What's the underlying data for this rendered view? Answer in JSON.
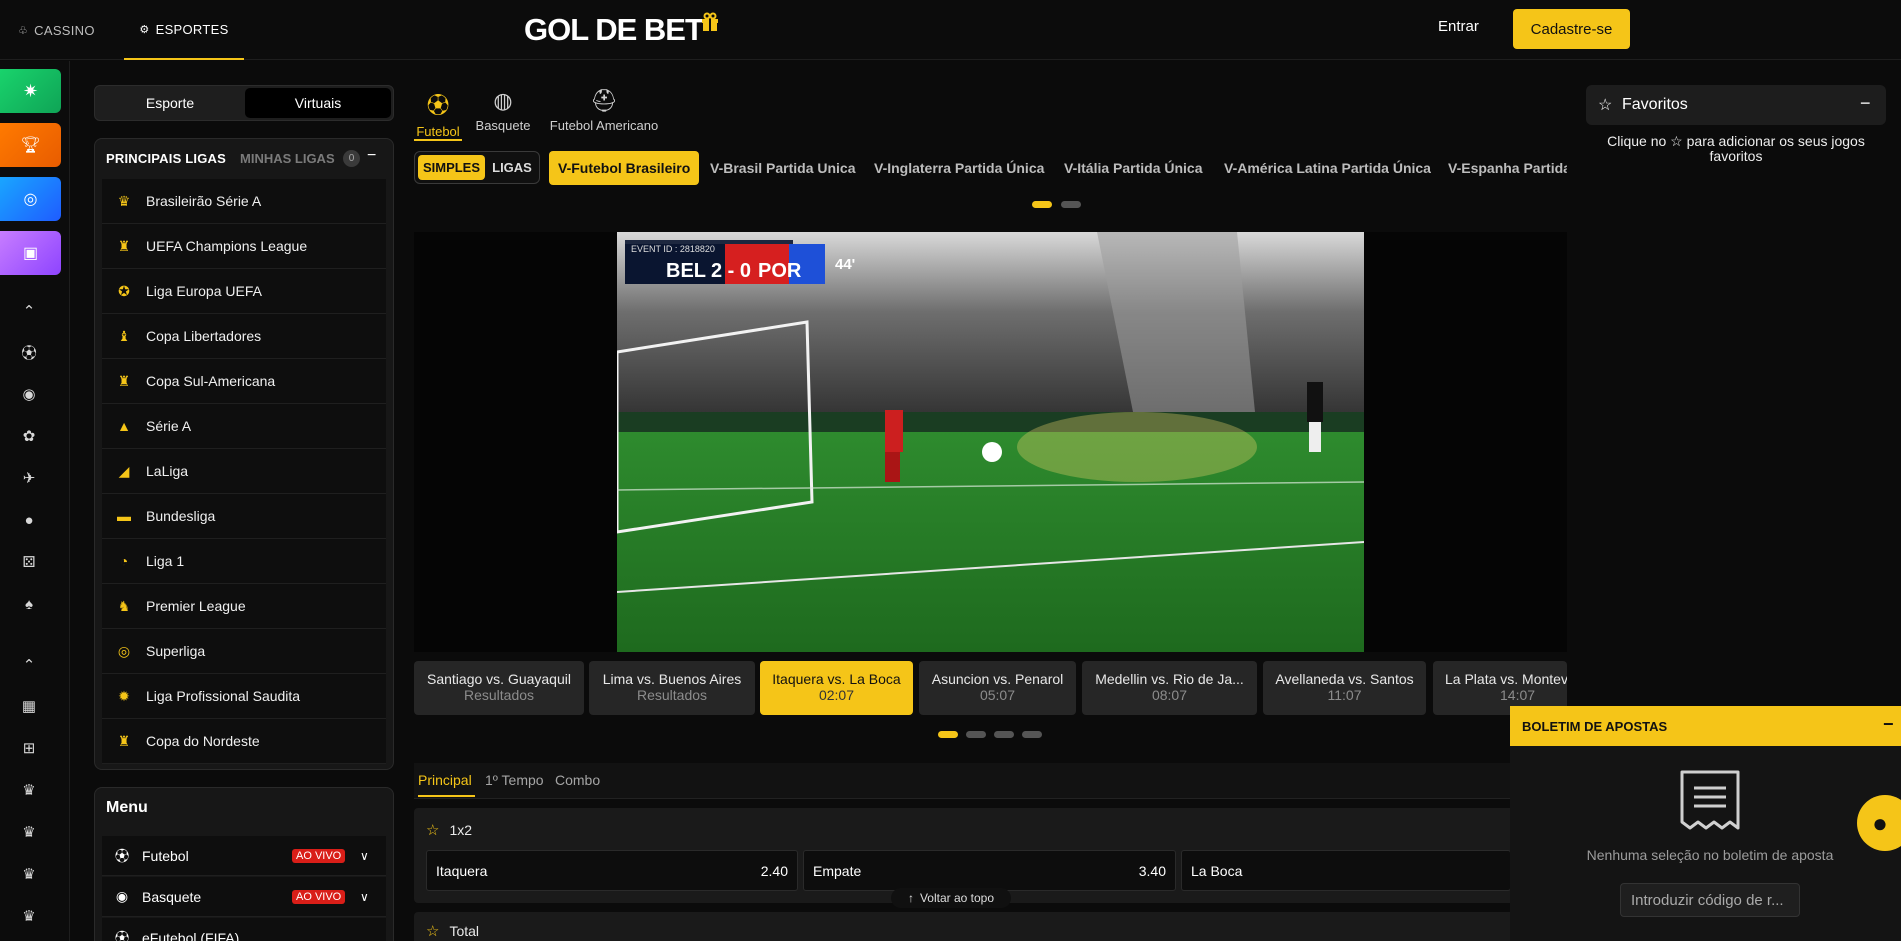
{
  "header": {
    "tab_casino": "CASSINO",
    "tab_esportes": "ESPORTES",
    "logo_text": "GOL DE BET",
    "login_label": "Entrar",
    "signup_label": "Cadastre-se"
  },
  "toggle": {
    "sport_label": "Esporte",
    "virtual_label": "Virtuais"
  },
  "leagues": {
    "title": "PRINCIPAIS LIGAS",
    "my_leagues": "MINHAS LIGAS",
    "my_count": "0",
    "items": [
      {
        "label": "Brasileirão Série A",
        "icon": "brasileirao-icon"
      },
      {
        "label": "UEFA Champions League",
        "icon": "trophy-icon"
      },
      {
        "label": "Liga Europa UEFA",
        "icon": "europa-icon"
      },
      {
        "label": "Copa Libertadores",
        "icon": "libertadores-icon"
      },
      {
        "label": "Copa Sul-Americana",
        "icon": "trophy-icon"
      },
      {
        "label": "Série A",
        "icon": "serie-a-icon"
      },
      {
        "label": "LaLiga",
        "icon": "laliga-icon"
      },
      {
        "label": "Bundesliga",
        "icon": "bundesliga-icon"
      },
      {
        "label": "Liga 1",
        "icon": "ligue1-icon"
      },
      {
        "label": "Premier League",
        "icon": "premier-league-icon"
      },
      {
        "label": "Superliga",
        "icon": "superliga-icon"
      },
      {
        "label": "Liga Profissional Saudita",
        "icon": "saudi-league-icon"
      },
      {
        "label": "Copa do Nordeste",
        "icon": "trophy-icon"
      }
    ]
  },
  "menu": {
    "title": "Menu",
    "items": [
      {
        "label": "Futebol",
        "badge": "AO VIVO"
      },
      {
        "label": "Basquete",
        "badge": "AO VIVO"
      },
      {
        "label": "eFutebol (FIFA)"
      }
    ]
  },
  "sports": {
    "futebol": "Futebol",
    "basquete": "Basquete",
    "americano": "Futebol Americano"
  },
  "league_bar": {
    "simples": "SIMPLES",
    "ligas": "LIGAS",
    "items": [
      "V-Futebol Brasileiro",
      "V-Brasil Partida Unica",
      "V-Inglaterra Partida Única",
      "V-Itália Partida Única",
      "V-América Latina Partida Única",
      "V-Espanha Partida"
    ]
  },
  "video": {
    "event_id": "EVENT ID : 2818820",
    "home": "BEL",
    "score": "2 - 0",
    "away": "POR",
    "minute": "44'"
  },
  "matches": [
    {
      "name": "Santiago vs. Guayaquil",
      "status": "Resultados"
    },
    {
      "name": "Lima vs. Buenos Aires",
      "status": "Resultados"
    },
    {
      "name": "Itaquera vs. La Boca",
      "status": "02:07"
    },
    {
      "name": "Asuncion vs. Penarol",
      "status": "05:07"
    },
    {
      "name": "Medellin vs. Rio de Ja...",
      "status": "08:07"
    },
    {
      "name": "Avellaneda vs. Santos",
      "status": "11:07"
    },
    {
      "name": "La Plata vs. Montev",
      "status": "14:07"
    }
  ],
  "market_tabs": {
    "principal": "Principal",
    "first_half": "1º Tempo",
    "combo": "Combo"
  },
  "market": {
    "title": "1x2",
    "odds": [
      {
        "label": "Itaquera",
        "value": "2.40"
      },
      {
        "label": "Empate",
        "value": "3.40"
      },
      {
        "label": "La Boca",
        "value": ""
      }
    ],
    "total_title": "Total"
  },
  "back_to_top": "Voltar ao topo",
  "favorites": {
    "title": "Favoritos",
    "hint": "Clique no ☆ para adicionar os seus jogos favoritos"
  },
  "betslip": {
    "title": "BOLETIM DE APOSTAS",
    "empty": "Nenhuma seleção no boletim de aposta",
    "code_placeholder": "Introduzir código de r..."
  },
  "colors": {
    "accent": "#f5c518",
    "live": "#d91e18",
    "background": "#0b0b0b"
  }
}
